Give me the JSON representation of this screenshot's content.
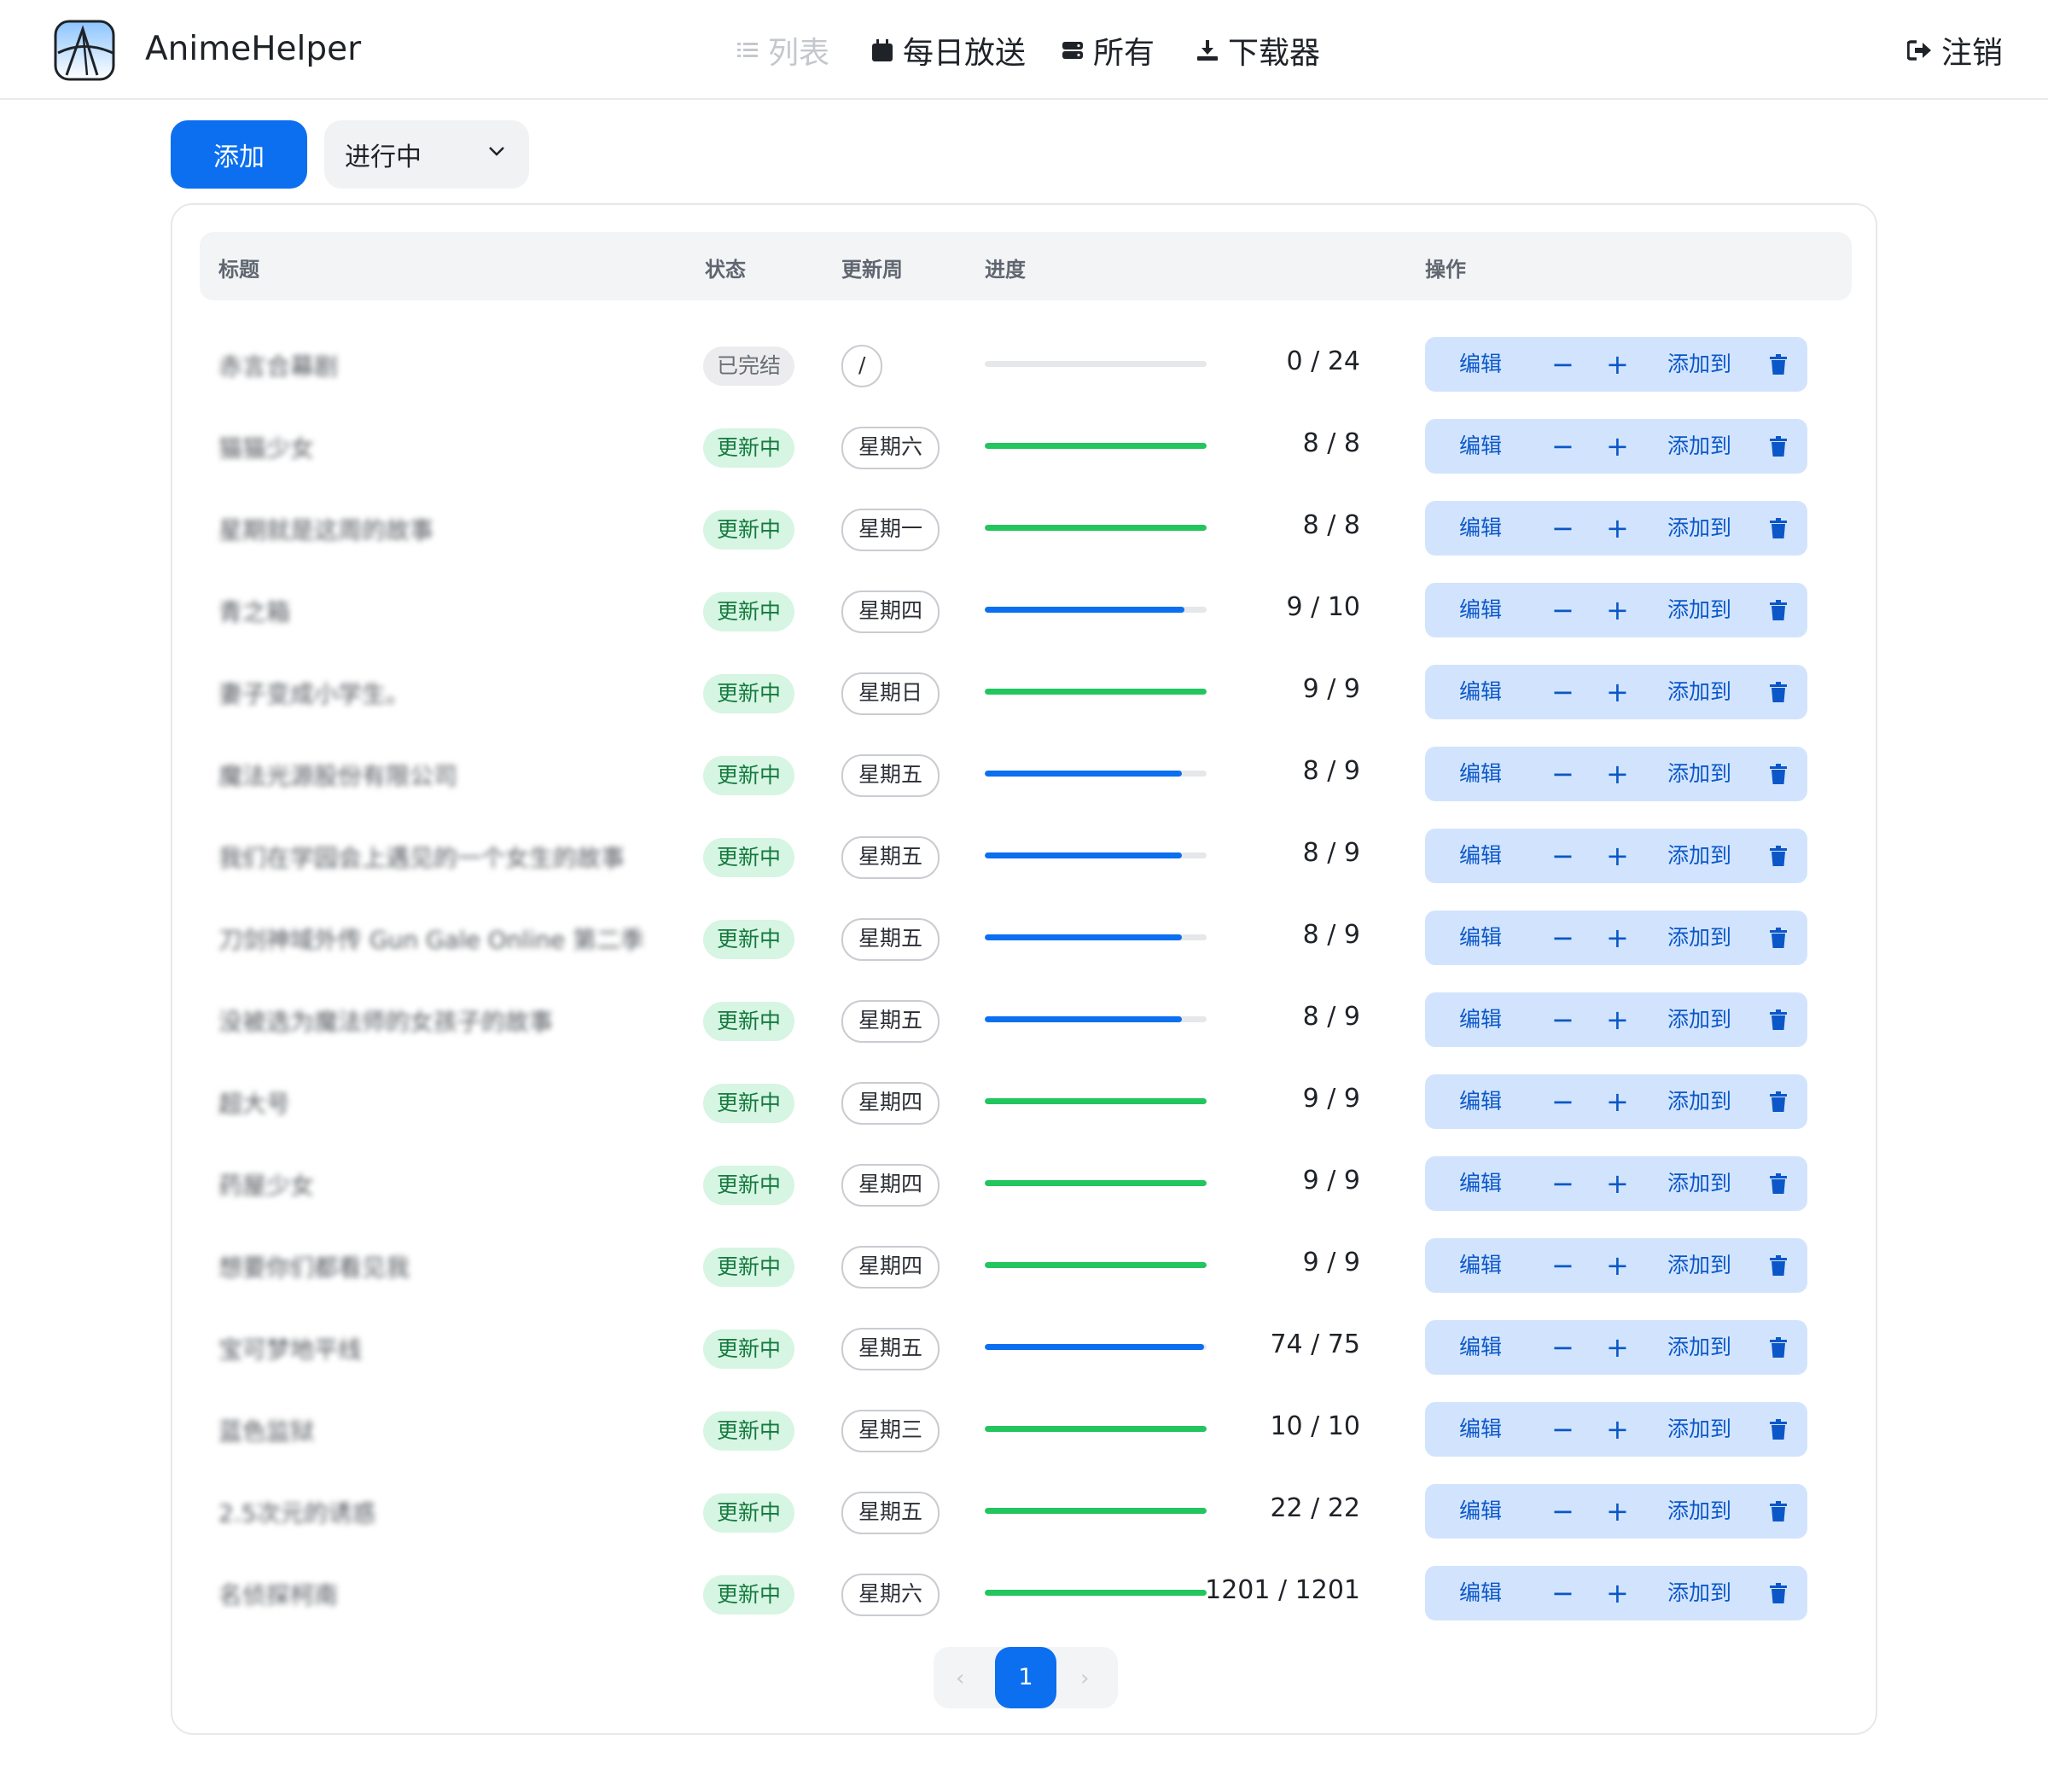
{
  "app": {
    "title": "AnimeHelper",
    "logo_icon": "app-logo-icon"
  },
  "nav": {
    "list": "列表",
    "daily": "每日放送",
    "all": "所有",
    "downloader": "下载器",
    "logout": "注销"
  },
  "toolbar": {
    "add_label": "添加",
    "filter_value": "进行中"
  },
  "table": {
    "headers": {
      "title": "标题",
      "status": "状态",
      "week": "更新周",
      "progress": "进度",
      "action": "操作"
    },
    "action_labels": {
      "edit": "编辑",
      "minus": "−",
      "plus": "+",
      "add_to": "添加到"
    },
    "rows": [
      {
        "title": "赤言合幕剧",
        "status": "已完结",
        "status_kind": "finished",
        "week": "/",
        "progress": "0 / 24",
        "fraction": 0,
        "complete": false
      },
      {
        "title": "猫猫少女",
        "status": "更新中",
        "status_kind": "updating",
        "week": "星期六",
        "progress": "8 / 8",
        "fraction": 1,
        "complete": true
      },
      {
        "title": "星期就是这周的故事",
        "status": "更新中",
        "status_kind": "updating",
        "week": "星期一",
        "progress": "8 / 8",
        "fraction": 1,
        "complete": true
      },
      {
        "title": "青之箱",
        "status": "更新中",
        "status_kind": "updating",
        "week": "星期四",
        "progress": "9 / 10",
        "fraction": 0.9,
        "complete": false
      },
      {
        "title": "妻子变成小学生。",
        "status": "更新中",
        "status_kind": "updating",
        "week": "星期日",
        "progress": "9 / 9",
        "fraction": 1,
        "complete": true
      },
      {
        "title": "魔法光源股份有限公司",
        "status": "更新中",
        "status_kind": "updating",
        "week": "星期五",
        "progress": "8 / 9",
        "fraction": 0.889,
        "complete": false
      },
      {
        "title": "我们在学园会上遇见的一个女生的故事",
        "status": "更新中",
        "status_kind": "updating",
        "week": "星期五",
        "progress": "8 / 9",
        "fraction": 0.889,
        "complete": false
      },
      {
        "title": "刀剑神域外传 Gun Gale Online 第二季",
        "status": "更新中",
        "status_kind": "updating",
        "week": "星期五",
        "progress": "8 / 9",
        "fraction": 0.889,
        "complete": false
      },
      {
        "title": "没被选为魔法师的女孩子的故事",
        "status": "更新中",
        "status_kind": "updating",
        "week": "星期五",
        "progress": "8 / 9",
        "fraction": 0.889,
        "complete": false
      },
      {
        "title": "超大号",
        "status": "更新中",
        "status_kind": "updating",
        "week": "星期四",
        "progress": "9 / 9",
        "fraction": 1,
        "complete": true
      },
      {
        "title": "药屋少女",
        "status": "更新中",
        "status_kind": "updating",
        "week": "星期四",
        "progress": "9 / 9",
        "fraction": 1,
        "complete": true
      },
      {
        "title": "想要你们都看见我",
        "status": "更新中",
        "status_kind": "updating",
        "week": "星期四",
        "progress": "9 / 9",
        "fraction": 1,
        "complete": true
      },
      {
        "title": "宝可梦地平线",
        "status": "更新中",
        "status_kind": "updating",
        "week": "星期五",
        "progress": "74 / 75",
        "fraction": 0.987,
        "complete": false
      },
      {
        "title": "蓝色监狱",
        "status": "更新中",
        "status_kind": "updating",
        "week": "星期三",
        "progress": "10 / 10",
        "fraction": 1,
        "complete": true
      },
      {
        "title": "2.5次元的诱惑",
        "status": "更新中",
        "status_kind": "updating",
        "week": "星期五",
        "progress": "22 / 22",
        "fraction": 1,
        "complete": true
      },
      {
        "title": "名侦探柯南",
        "status": "更新中",
        "status_kind": "updating",
        "week": "星期六",
        "progress": "1201 / 1201",
        "fraction": 1,
        "complete": true
      }
    ]
  },
  "pagination": {
    "current": "1",
    "prev": "‹",
    "next": "›"
  },
  "colors": {
    "accent": "#0b6ff0",
    "complete": "#22c55e",
    "action_bg": "#d2e4fd"
  }
}
